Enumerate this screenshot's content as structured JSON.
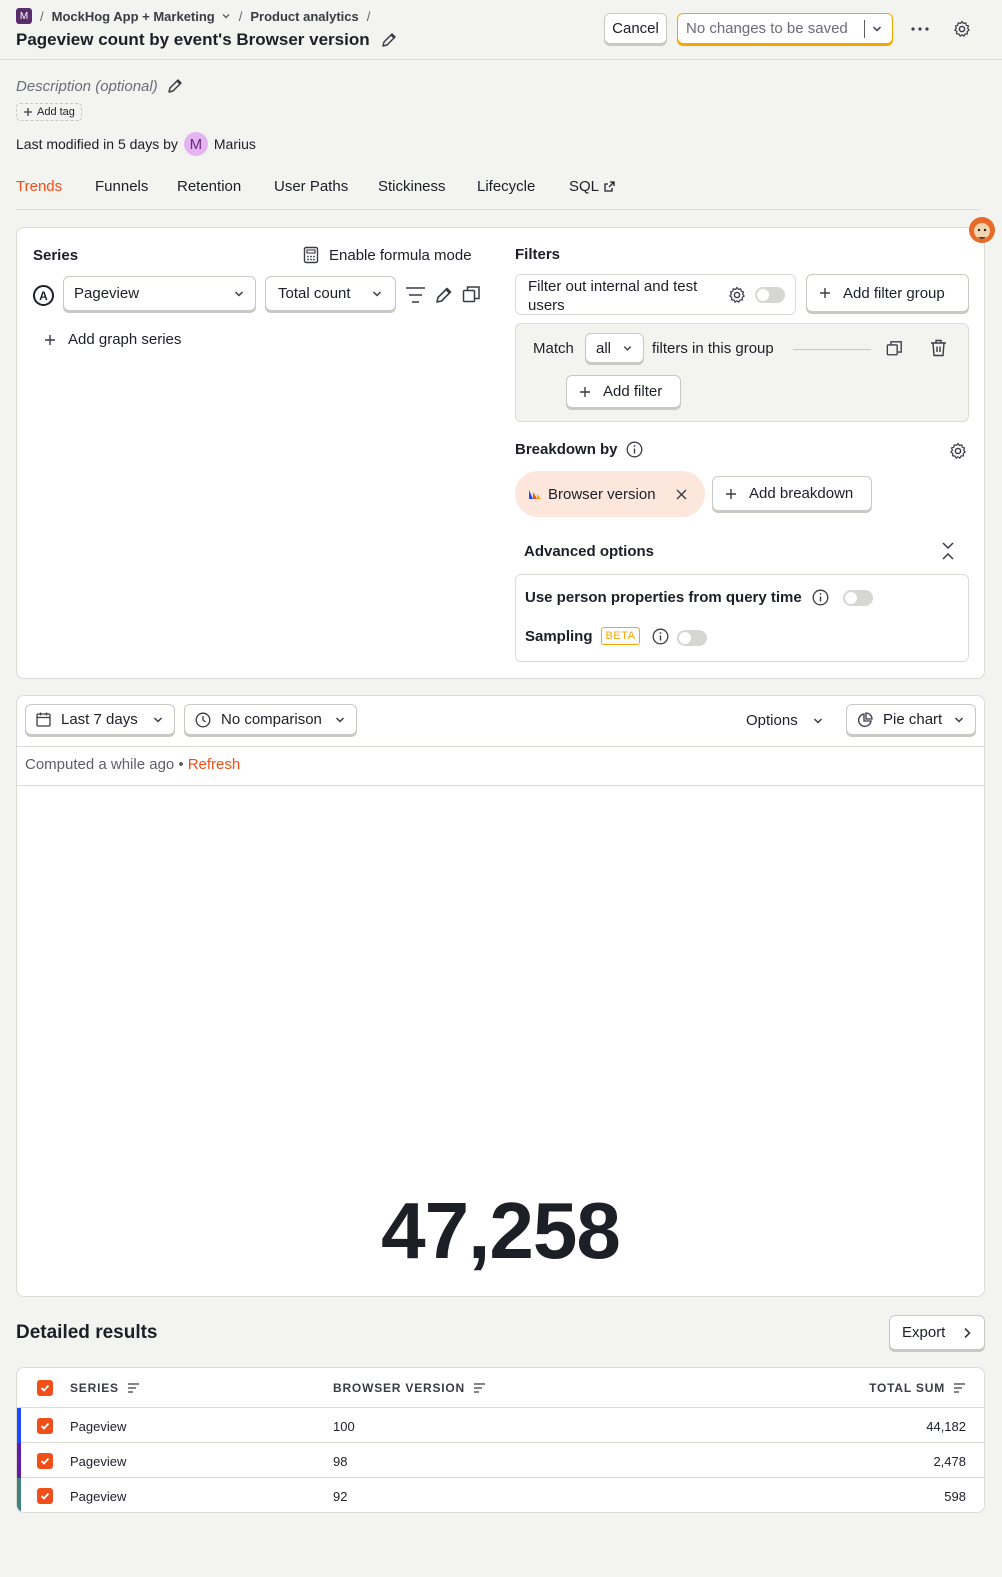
{
  "breadcrumb": {
    "project_initial": "M",
    "project": "MockHog App + Marketing",
    "section": "Product analytics",
    "separator": "/"
  },
  "title": "Pageview count by event's Browser version",
  "header_actions": {
    "cancel": "Cancel",
    "save_status": "No changes to be saved"
  },
  "meta": {
    "description_placeholder": "Description (optional)",
    "add_tag": "Add tag",
    "last_modified": "Last modified in 5 days by",
    "user_initial": "M",
    "user_name": "Marius"
  },
  "tabs": [
    {
      "label": "Trends",
      "active": true
    },
    {
      "label": "Funnels"
    },
    {
      "label": "Retention"
    },
    {
      "label": "User Paths"
    },
    {
      "label": "Stickiness"
    },
    {
      "label": "Lifecycle"
    },
    {
      "label": "SQL"
    }
  ],
  "series": {
    "heading": "Series",
    "formula_mode": "Enable formula mode",
    "letter": "A",
    "event": "Pageview",
    "aggregation": "Total count",
    "add_series": "Add graph series"
  },
  "filters": {
    "heading": "Filters",
    "internal_filter": "Filter out internal and test users",
    "add_filter_group": "Add filter group",
    "match_label": "Match",
    "match_value": "all",
    "match_suffix": "filters in this group",
    "add_filter": "Add filter"
  },
  "breakdown": {
    "heading": "Breakdown by",
    "chip": "Browser version",
    "add_breakdown": "Add breakdown"
  },
  "advanced": {
    "heading": "Advanced options",
    "person_props": "Use person properties from query time",
    "sampling": "Sampling",
    "beta": "BETA"
  },
  "toolbar": {
    "date_range": "Last 7 days",
    "comparison": "No comparison",
    "options": "Options",
    "chart_type": "Pie chart"
  },
  "computed": {
    "text": "Computed a while ago •",
    "refresh": "Refresh"
  },
  "total": "47,258",
  "results": {
    "heading": "Detailed results",
    "export": "Export",
    "columns": [
      "SERIES",
      "BROWSER VERSION",
      "TOTAL SUM"
    ],
    "rows": [
      {
        "series": "Pageview",
        "version": "100",
        "sum": "44,182",
        "color": "#1d4aff"
      },
      {
        "series": "Pageview",
        "version": "98",
        "sum": "2,478",
        "color": "#621da6"
      },
      {
        "series": "Pageview",
        "version": "92",
        "sum": "598",
        "color": "#42827e"
      }
    ]
  },
  "colors": {
    "accent": "#f04f1a",
    "save_border": "#f7a501"
  }
}
